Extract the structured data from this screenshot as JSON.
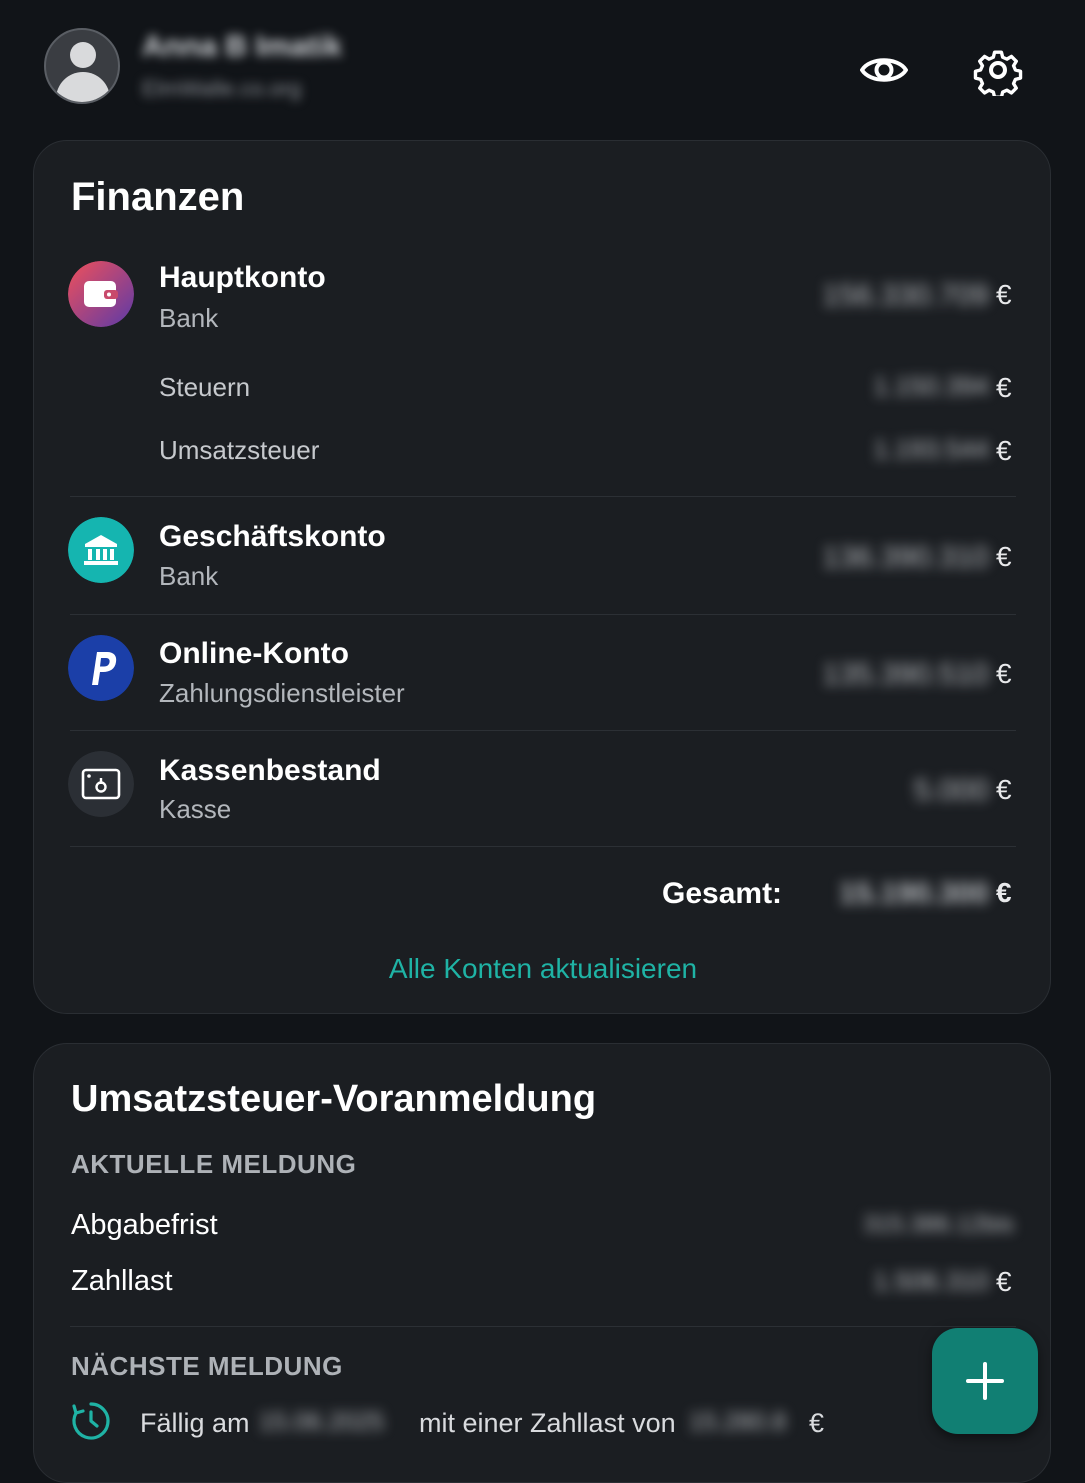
{
  "header": {
    "user_name": "Anna B Imatik",
    "user_sub": "ElmWalle.co.org",
    "visibility_icon": "eye-icon",
    "settings_icon": "gear-icon"
  },
  "finances": {
    "title": "Finanzen",
    "accounts": [
      {
        "name": "Hauptkonto",
        "type": "Bank",
        "value": "156.330.709",
        "currency": "€",
        "icon": "wallet-icon",
        "icon_colors": [
          "#e8505b",
          "#6a3fa8"
        ],
        "sub_items": [
          {
            "label": "Steuern",
            "value": "1.150.394",
            "currency": "€"
          },
          {
            "label": "Umsatzsteuer",
            "value": "1.193.544",
            "currency": "€"
          }
        ]
      },
      {
        "name": "Geschäftskonto",
        "type": "Bank",
        "value": "136.390.310",
        "currency": "€",
        "icon": "bank-icon",
        "icon_color": "#15b5b0"
      },
      {
        "name": "Online-Konto",
        "type": "Zahlungsdienstleister",
        "value": "135.390.510",
        "currency": "€",
        "icon": "paypal-icon",
        "icon_color": "#1b3fa8"
      },
      {
        "name": "Kassenbestand",
        "type": "Kasse",
        "value": "5.000",
        "currency": "€",
        "icon": "cash-register-icon",
        "icon_color": "#2b2f35"
      }
    ],
    "total_label": "Gesamt:",
    "total_value": "15.190.300",
    "total_currency": "€",
    "update_link": "Alle Konten aktualisieren"
  },
  "vat": {
    "title": "Umsatzsteuer-Voranmeldung",
    "current_caption": "AKTUELLE MELDUNG",
    "deadline_label": "Abgabefrist",
    "deadline_value": "315.386.12bis",
    "payable_label": "Zahllast",
    "payable_value": "1.506.310",
    "payable_currency": "€",
    "next_caption": "NÄCHSTE MELDUNG",
    "next_due_prefix": "Fällig am",
    "next_due_date": "15.06.2025",
    "next_due_mid": "mit einer Zahllast von",
    "next_due_amount": "15.280.8",
    "next_due_currency": "€",
    "clock_icon": "clock-icon"
  },
  "fab": {
    "icon": "plus-icon",
    "color": "#117f73"
  },
  "accent_color": "#1fb3a5"
}
